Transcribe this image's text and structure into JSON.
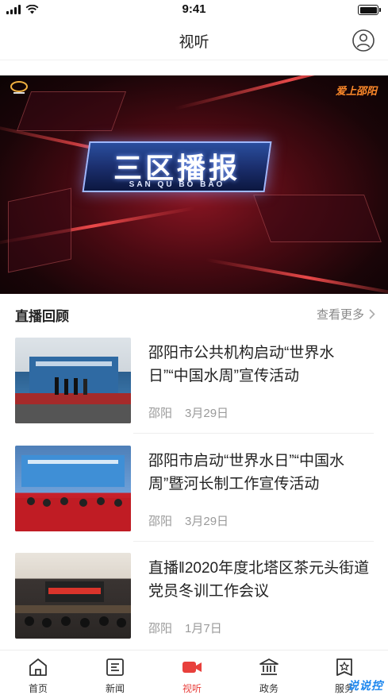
{
  "status_bar": {
    "time": "9:41"
  },
  "header": {
    "title": "视听"
  },
  "banner": {
    "title": "三区播报",
    "pinyin": "SAN QU BO BAO",
    "logo_right": "爱上邵阳"
  },
  "section": {
    "title": "直播回顾",
    "more_label": "查看更多"
  },
  "news": [
    {
      "title": "邵阳市公共机构启动“世界水日”“中国水周”宣传活动",
      "source": "邵阳",
      "date": "3月29日"
    },
    {
      "title": "邵阳市启动“世界水日”“中国水周”暨河长制工作宣传活动",
      "source": "邵阳",
      "date": "3月29日"
    },
    {
      "title": "直播‖2020年度北塔区茶元头街道党员冬训工作会议",
      "source": "邵阳",
      "date": "1月7日"
    }
  ],
  "tabs": [
    {
      "label": "首页",
      "icon": "home-icon"
    },
    {
      "label": "新闻",
      "icon": "news-icon"
    },
    {
      "label": "视听",
      "icon": "video-camera-icon"
    },
    {
      "label": "政务",
      "icon": "government-icon"
    },
    {
      "label": "服务",
      "icon": "service-icon"
    }
  ],
  "active_tab": 2,
  "colors": {
    "accent": "#e8403c",
    "text": "#222222",
    "meta": "#9a9a9a"
  },
  "watermark": "说说控"
}
